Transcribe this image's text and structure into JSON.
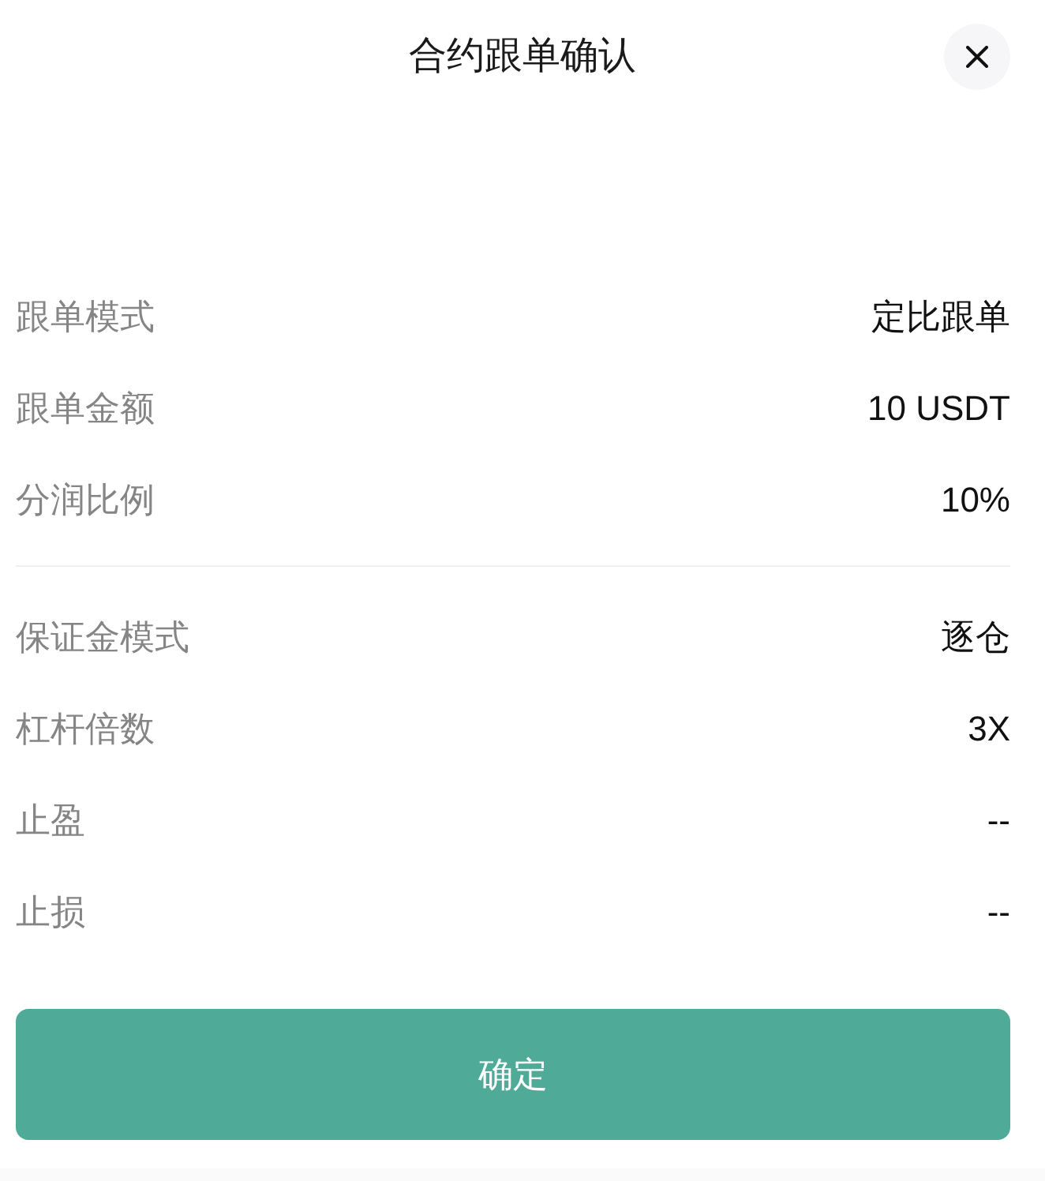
{
  "title": "合约跟单确认",
  "sections": [
    {
      "rows": [
        {
          "label": "跟单模式",
          "value": "定比跟单"
        },
        {
          "label": "跟单金额",
          "value": "10 USDT"
        },
        {
          "label": "分润比例",
          "value": "10%"
        }
      ]
    },
    {
      "rows": [
        {
          "label": "保证金模式",
          "value": "逐仓"
        },
        {
          "label": "杠杆倍数",
          "value": "3X"
        },
        {
          "label": "止盈",
          "value": "--"
        },
        {
          "label": "止损",
          "value": "--"
        }
      ]
    }
  ],
  "confirm_button": "确定"
}
